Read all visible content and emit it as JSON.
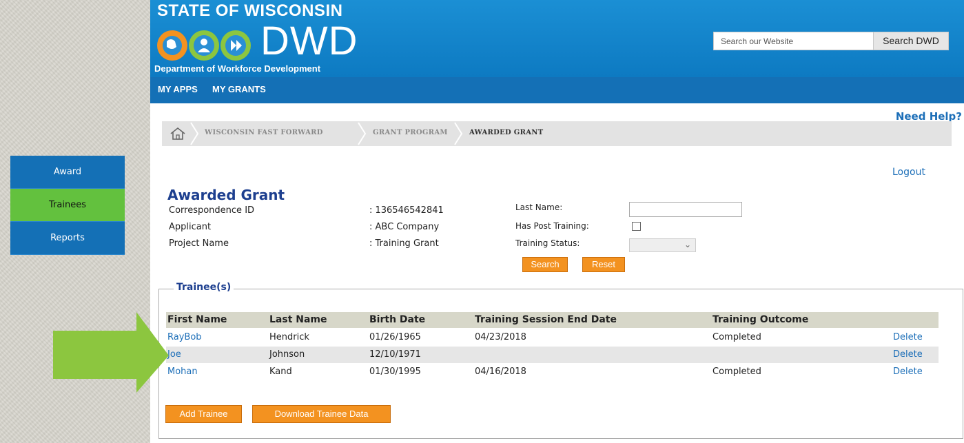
{
  "header": {
    "state_text": "STATE OF WISCONSIN",
    "agency_abbr": "DWD",
    "agency_name": "Department of Workforce Development",
    "search_placeholder": "Search our Website",
    "search_button": "Search DWD"
  },
  "nav": {
    "items": [
      "MY APPS",
      "MY GRANTS"
    ]
  },
  "help": {
    "label": "Need Help?"
  },
  "breadcrumb": {
    "items": [
      "WISCONSIN FAST FORWARD",
      "GRANT PROGRAM",
      "AWARDED GRANT"
    ]
  },
  "logout": "Logout",
  "sidebar": {
    "items": [
      {
        "label": "Award",
        "active": false
      },
      {
        "label": "Trainees",
        "active": true
      },
      {
        "label": "Reports",
        "active": false
      }
    ]
  },
  "summary": {
    "title": "Awarded Grant",
    "fields": [
      {
        "label": "Correspondence ID",
        "value": ": 136546542841"
      },
      {
        "label": "Applicant",
        "value": ": ABC Company"
      },
      {
        "label": "Project Name",
        "value": ": Training Grant"
      }
    ]
  },
  "filters": {
    "last_name_label": "Last Name:",
    "last_name_value": "",
    "post_training_label": "Has Post Training:",
    "post_training_checked": false,
    "status_label": "Training Status:",
    "status_value": "",
    "search_button": "Search",
    "reset_button": "Reset"
  },
  "trainees": {
    "legend": "Trainee(s)",
    "columns": [
      "First Name",
      "Last Name",
      "Birth Date",
      "Training Session End Date",
      "Training Outcome"
    ],
    "rows": [
      {
        "first": "RayBob",
        "last": "Hendrick",
        "birth": "01/26/1965",
        "end_date": "04/23/2018",
        "outcome": "Completed",
        "action": "Delete"
      },
      {
        "first": "Joe",
        "last": "Johnson",
        "birth": "12/10/1971",
        "end_date": "",
        "outcome": "",
        "action": "Delete"
      },
      {
        "first": "Mohan",
        "last": "Kand",
        "birth": "01/30/1995",
        "end_date": "04/16/2018",
        "outcome": "Completed",
        "action": "Delete"
      }
    ],
    "add_button": "Add Trainee",
    "download_button": "Download Trainee Data"
  },
  "colors": {
    "header_blue": "#1b8fd4",
    "nav_blue": "#1470b6",
    "active_green": "#63c13e",
    "button_orange": "#f39220",
    "arrow_green": "#8cc63f"
  }
}
